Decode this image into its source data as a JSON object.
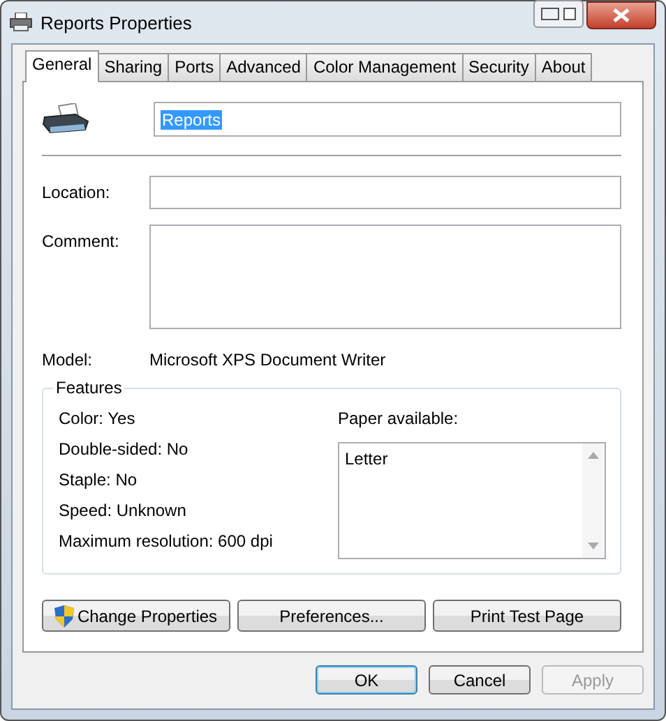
{
  "window": {
    "title": "Reports Properties"
  },
  "tabs": [
    {
      "label": "General",
      "selected": true
    },
    {
      "label": "Sharing",
      "selected": false
    },
    {
      "label": "Ports",
      "selected": false
    },
    {
      "label": "Advanced",
      "selected": false
    },
    {
      "label": "Color Management",
      "selected": false
    },
    {
      "label": "Security",
      "selected": false
    },
    {
      "label": "About",
      "selected": false
    }
  ],
  "printer_name": {
    "value": "Reports",
    "highlighted": true
  },
  "fields": [
    {
      "label": "Location:",
      "kind": "line"
    },
    {
      "label": "Comment:",
      "kind": "area"
    }
  ],
  "model": {
    "label": "Model:",
    "value": "Microsoft XPS Document Writer"
  },
  "features": {
    "title": "Features",
    "items": [
      "Color: Yes",
      "Double-sided: No",
      "Staple: No",
      "Speed: Unknown",
      "Maximum resolution: 600 dpi"
    ],
    "paper_label": "Paper available:",
    "paper": [
      "Letter"
    ]
  },
  "action_buttons": [
    {
      "label": "Change Properties",
      "shield": true
    },
    {
      "label": "Preferences...",
      "shield": false
    },
    {
      "label": "Print Test Page",
      "shield": false
    }
  ],
  "buttons": [
    {
      "label": "OK",
      "default": true,
      "disabled": false
    },
    {
      "label": "Cancel",
      "default": false,
      "disabled": false
    },
    {
      "label": "Apply",
      "default": false,
      "disabled": true
    }
  ]
}
